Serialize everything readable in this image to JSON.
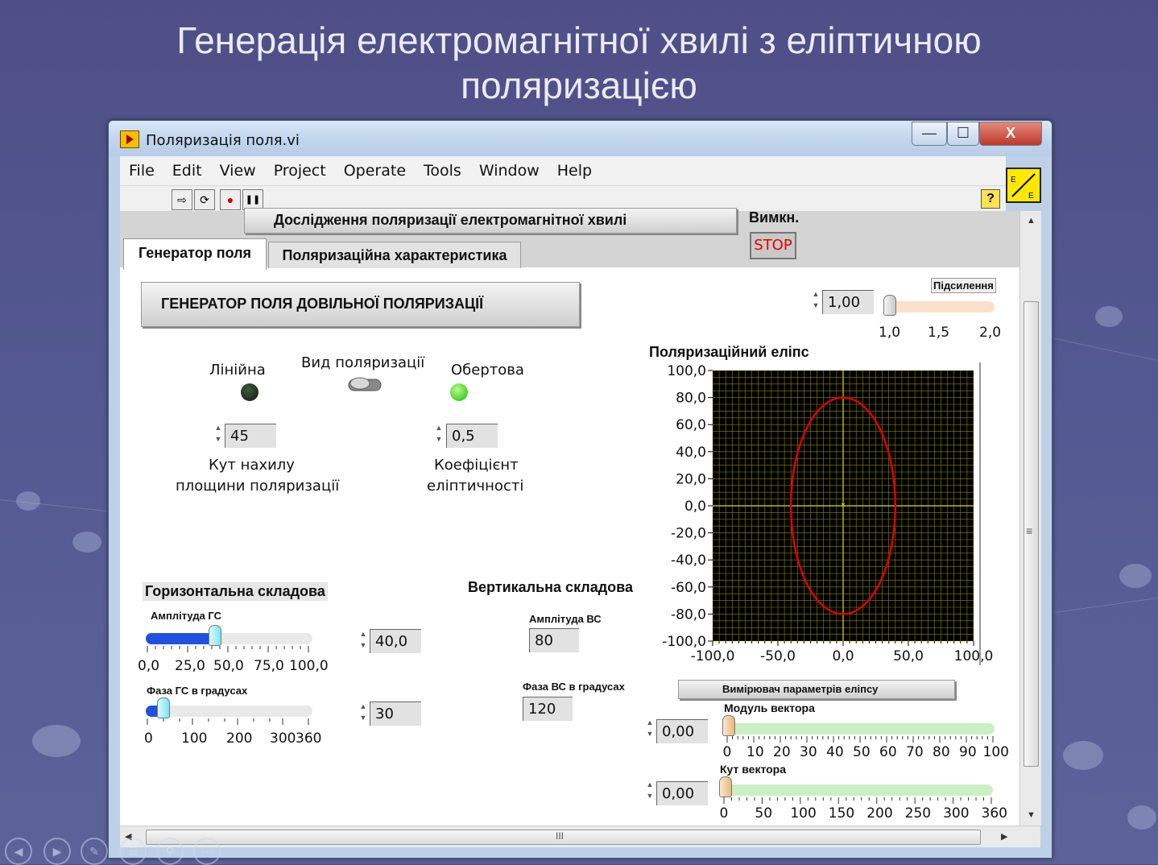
{
  "slide": {
    "title_line1": "Генерація електромагнітної хвилі з еліптичною",
    "title_line2": "поляризацією"
  },
  "window": {
    "title": "Поляризація поля.vi",
    "minimize": "—",
    "maximize": "☐",
    "close": "X"
  },
  "menu": [
    "File",
    "Edit",
    "View",
    "Project",
    "Operate",
    "Tools",
    "Window",
    "Help"
  ],
  "toolbar": {
    "run": "⇨",
    "run_continuous": "⟳",
    "abort": "●",
    "pause": "❚❚",
    "help": "?"
  },
  "vi_icon": {
    "label": "E→E"
  },
  "header": {
    "title": "Дослідження поляризації електромагнітної хвилі",
    "off_label": "Вимкн.",
    "stop_label": "STOP"
  },
  "tabs": [
    {
      "label": "Генератор поля",
      "active": true
    },
    {
      "label": "Поляризаційна характеристика",
      "active": false
    }
  ],
  "generator": {
    "heading": "ГЕНЕРАТОР ПОЛЯ ДОВІЛЬНОЇ ПОЛЯРИЗАЦІЇ",
    "linear_label": "Лінійна",
    "type_label": "Вид поляризації",
    "rotating_label": "Обертова",
    "linear_led": false,
    "rotating_led": true,
    "angle_value": "45",
    "angle_label_1": "Кут нахилу",
    "angle_label_2": "площини поляризації",
    "ellipticity_value": "0,5",
    "ellipticity_label_1": "Коефіцієнт",
    "ellipticity_label_2": "еліптичності"
  },
  "horizontal": {
    "heading": "Горизонтальна складова",
    "amp_label": "Амплітуда ГС",
    "amp_ticks": [
      "0,0",
      "25,0",
      "50,0",
      "75,0",
      "100,0"
    ],
    "amp_value": "40,0",
    "amp_fraction": 0.4,
    "phase_label": "Фаза ГС в градусах",
    "phase_ticks": [
      "0",
      "100",
      "200",
      "300",
      "360"
    ],
    "phase_value": "30",
    "phase_fraction": 0.083
  },
  "vertical": {
    "heading": "Вертикальна складова",
    "amp_label": "Амплітуда ВС",
    "amp_value": "80",
    "phase_label": "Фаза ВС в градусах",
    "phase_value": "120"
  },
  "gain": {
    "label": "Підсилення",
    "value": "1,00",
    "ticks": [
      "1,0",
      "1,5",
      "2,0"
    ],
    "fraction": 0.0
  },
  "chart_data": {
    "type": "line",
    "title": "Поляризаційний еліпс",
    "xlim": [
      -100,
      100
    ],
    "ylim": [
      -100,
      100
    ],
    "x_ticks": [
      "-100,0",
      "-50,0",
      "0,0",
      "50,0",
      "100,0"
    ],
    "y_ticks": [
      "100,0",
      "80,0",
      "60,0",
      "40,0",
      "20,0",
      "0,0",
      "-20,0",
      "-40,0",
      "-60,0",
      "-80,0",
      "-100,0"
    ],
    "grid": true,
    "series": [
      {
        "shape": "ellipse",
        "center": [
          0,
          0
        ],
        "semi_x": 40,
        "semi_y": 80,
        "color": "#e00000"
      }
    ],
    "background": "#000000",
    "grid_color": "#b8b800"
  },
  "meter": {
    "heading": "Вимірювач параметрів еліпсу",
    "modulus_label": "Модуль вектора",
    "modulus_value": "0,00",
    "modulus_ticks": [
      "0",
      "10",
      "20",
      "30",
      "40",
      "50",
      "60",
      "70",
      "80",
      "90",
      "100"
    ],
    "angle_label": "Кут вектора",
    "angle_value": "0,00",
    "angle_ticks": [
      "0",
      "50",
      "100",
      "150",
      "200",
      "250",
      "300",
      "360"
    ]
  },
  "scroll": {
    "h_grip": "III",
    "v_grip": "≡"
  },
  "slide_nav": {
    "prev": "◀",
    "next": "▶",
    "pen": "✎",
    "menu": "☰",
    "zoom": "⚲",
    "more": "···"
  }
}
